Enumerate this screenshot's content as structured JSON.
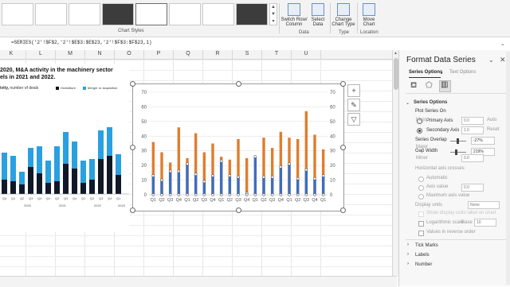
{
  "ribbon": {
    "chart_styles_label": "Chart Styles",
    "data_group_label": "Data",
    "type_group_label": "Type",
    "location_group_label": "Location",
    "switch_row_col": [
      "Switch Row/",
      "Column"
    ],
    "select_data": [
      "Select",
      "Data"
    ],
    "change_chart_type": [
      "Change",
      "Chart Type"
    ],
    "move_chart": [
      "Move",
      "Chart"
    ]
  },
  "formula_bar": {
    "formula": "=SERIES('2'!$F$2,'2'!$E$3:$E$23,'2'!$F$3:$F$23,1)"
  },
  "columns": [
    "K",
    "L",
    "M",
    "N",
    "O",
    "P",
    "Q",
    "R",
    "S",
    "T",
    "U"
  ],
  "left_chart": {
    "title_line1": "2020, M&A activity in the machinery sector",
    "title_line2": "els in 2021 and 2022.",
    "subtitle_bold": "ivity,",
    "subtitle_rest": " number of deals",
    "legend_divestiture": "Divestiture",
    "legend_merger": "Merger or acquisition",
    "year_labels": [
      "2020",
      "2021",
      "2022",
      "2023"
    ],
    "quarter_labels": [
      "Q4",
      "Q1",
      "Q2",
      "Q3",
      "Q4",
      "Q1",
      "Q2",
      "Q3",
      "Q4",
      "Q1",
      "Q2",
      "Q3",
      "Q4",
      "Q1"
    ]
  },
  "chart_data": {
    "type": "bar",
    "categories": [
      "Q1",
      "Q2",
      "Q3",
      "Q4",
      "Q1",
      "Q2",
      "Q3",
      "Q4",
      "Q1",
      "Q2",
      "Q3",
      "Q4",
      "Q1",
      "Q2",
      "Q3",
      "Q4",
      "Q1",
      "Q2",
      "Q3",
      "Q4",
      "Q1"
    ],
    "series": [
      {
        "values": [
          13,
          10,
          16,
          16,
          21,
          14,
          9,
          13,
          23,
          13,
          12,
          1,
          26,
          12,
          12,
          19,
          21,
          11,
          17,
          11,
          13
        ],
        "color": "#3f6dbc"
      },
      {
        "values": [
          36,
          29,
          22,
          46,
          25,
          42,
          29,
          35,
          26,
          24,
          38,
          25,
          2,
          39,
          32,
          43,
          39,
          38,
          57,
          41,
          31
        ],
        "color": "#e07d2e"
      }
    ],
    "ylim": [
      0,
      70
    ],
    "yticks": [
      0,
      10,
      20,
      30,
      40,
      50,
      60,
      70
    ],
    "grid": true
  },
  "pane": {
    "title": "Format Data Series",
    "tab_series_options": "Series Options",
    "tab_text_options": "Text Options",
    "section_series_options": "Series Options",
    "plot_series_on": "Plot Series On",
    "primary_axis": "Primary Axis",
    "secondary_axis": "Secondary Axis",
    "series_overlap": "Series Overlap",
    "series_overlap_value": "-27%",
    "gap_width": "Gap Width",
    "gap_width_value": "219%",
    "major": "Major",
    "minor": "Minor",
    "auto": "Auto",
    "reset": "Reset",
    "val_0": "0.0",
    "val_1": "1.0",
    "horizontal_axis_crosses": "Horizontal axis crosses",
    "automatic": "Automatic",
    "axis_value": "Axis value",
    "axis_value_field": "0.0",
    "maximum_axis_value": "Maximum axis value",
    "display_units": "Display units",
    "display_units_value": "None",
    "show_display_units": "Show display units label on chart",
    "logarithmic_scale": "Logarithmic scale",
    "log_base": "Base",
    "log_base_value": "10",
    "values_reverse": "Values in reverse order",
    "tick_marks": "Tick Marks",
    "labels": "Labels",
    "number": "Number"
  }
}
